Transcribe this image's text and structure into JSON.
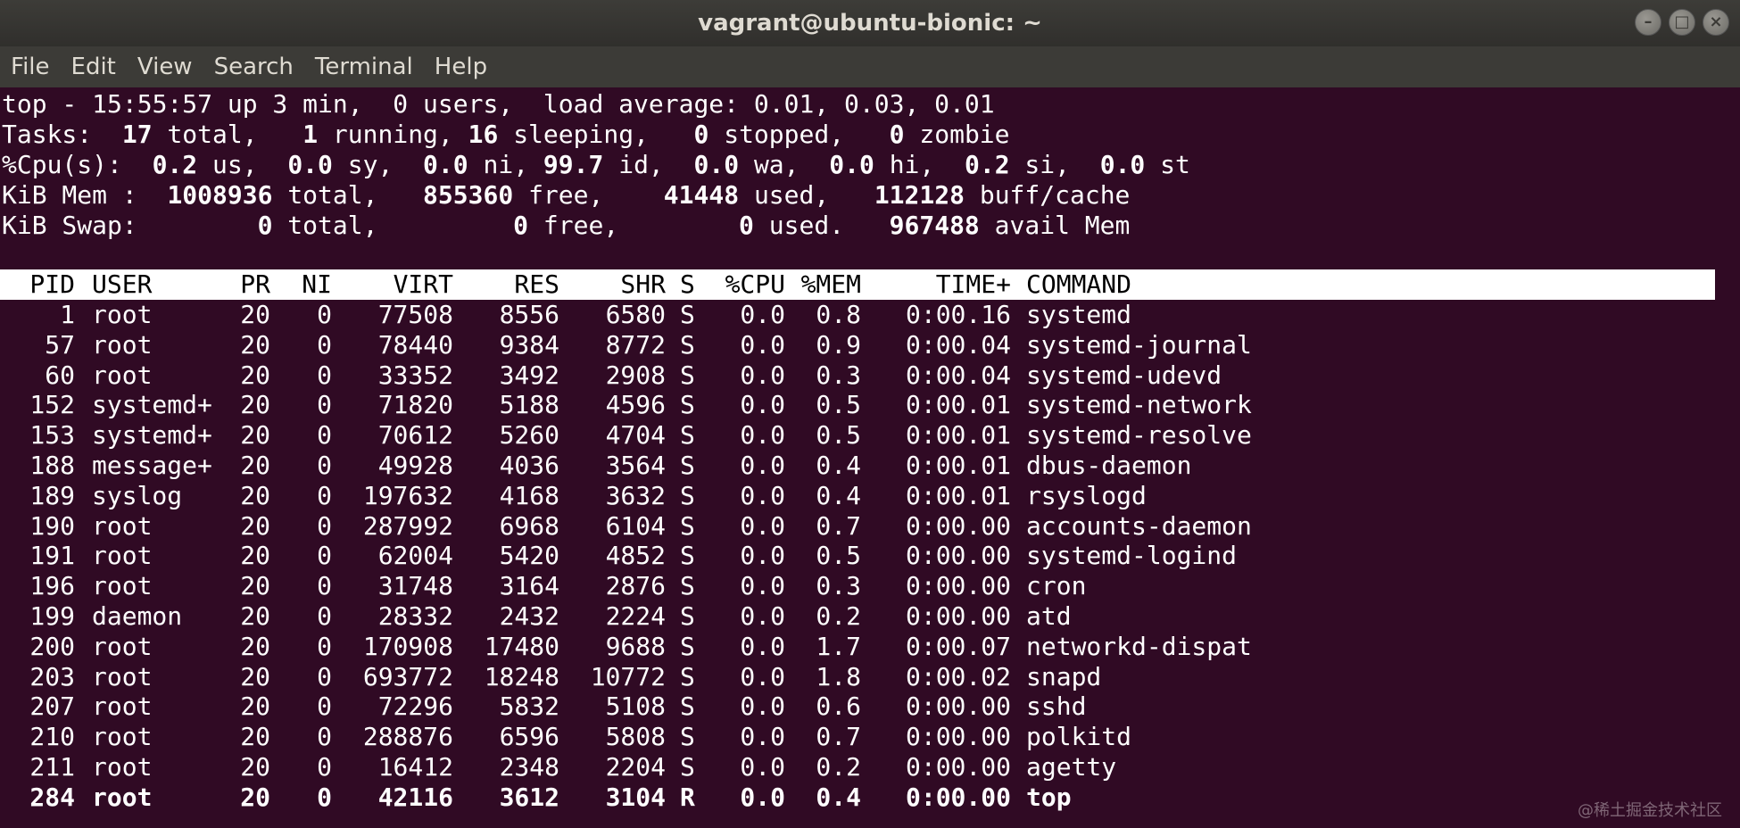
{
  "window": {
    "title": "vagrant@ubuntu-bionic: ~",
    "buttons": [
      "–",
      "□",
      "×"
    ]
  },
  "menu": [
    "File",
    "Edit",
    "View",
    "Search",
    "Terminal",
    "Help"
  ],
  "summary": {
    "line1": "top - 15:55:57 up 3 min,  0 users,  load average: 0.01, 0.03, 0.01",
    "tasks": {
      "label": "Tasks:",
      "total": "17",
      "total_lbl": "total,",
      "running": "1",
      "running_lbl": "running,",
      "sleeping": "16",
      "sleeping_lbl": "sleeping,",
      "stopped": "0",
      "stopped_lbl": "stopped,",
      "zombie": "0",
      "zombie_lbl": "zombie"
    },
    "cpu": {
      "label": "%Cpu(s):",
      "us": "0.2",
      "us_lbl": "us,",
      "sy": "0.0",
      "sy_lbl": "sy,",
      "ni": "0.0",
      "ni_lbl": "ni,",
      "id": "99.7",
      "id_lbl": "id,",
      "wa": "0.0",
      "wa_lbl": "wa,",
      "hi": "0.0",
      "hi_lbl": "hi,",
      "si": "0.2",
      "si_lbl": "si,",
      "st": "0.0",
      "st_lbl": "st"
    },
    "mem": {
      "label": "KiB Mem :",
      "total": "1008936",
      "total_lbl": "total,",
      "free": "855360",
      "free_lbl": "free,",
      "used": "41448",
      "used_lbl": "used,",
      "buff": "112128",
      "buff_lbl": "buff/cache"
    },
    "swap": {
      "label": "KiB Swap:",
      "total": "0",
      "total_lbl": "total,",
      "free": "0",
      "free_lbl": "free,",
      "used": "0",
      "used_lbl": "used.",
      "avail": "967488",
      "avail_lbl": "avail Mem"
    }
  },
  "table": {
    "headers": [
      "PID",
      "USER",
      "PR",
      "NI",
      "VIRT",
      "RES",
      "SHR",
      "S",
      "%CPU",
      "%MEM",
      "TIME+",
      "COMMAND"
    ],
    "rows": [
      [
        "1",
        "root",
        "20",
        "0",
        "77508",
        "8556",
        "6580",
        "S",
        "0.0",
        "0.8",
        "0:00.16",
        "systemd"
      ],
      [
        "57",
        "root",
        "20",
        "0",
        "78440",
        "9384",
        "8772",
        "S",
        "0.0",
        "0.9",
        "0:00.04",
        "systemd-journal"
      ],
      [
        "60",
        "root",
        "20",
        "0",
        "33352",
        "3492",
        "2908",
        "S",
        "0.0",
        "0.3",
        "0:00.04",
        "systemd-udevd"
      ],
      [
        "152",
        "systemd+",
        "20",
        "0",
        "71820",
        "5188",
        "4596",
        "S",
        "0.0",
        "0.5",
        "0:00.01",
        "systemd-network"
      ],
      [
        "153",
        "systemd+",
        "20",
        "0",
        "70612",
        "5260",
        "4704",
        "S",
        "0.0",
        "0.5",
        "0:00.01",
        "systemd-resolve"
      ],
      [
        "188",
        "message+",
        "20",
        "0",
        "49928",
        "4036",
        "3564",
        "S",
        "0.0",
        "0.4",
        "0:00.01",
        "dbus-daemon"
      ],
      [
        "189",
        "syslog",
        "20",
        "0",
        "197632",
        "4168",
        "3632",
        "S",
        "0.0",
        "0.4",
        "0:00.01",
        "rsyslogd"
      ],
      [
        "190",
        "root",
        "20",
        "0",
        "287992",
        "6968",
        "6104",
        "S",
        "0.0",
        "0.7",
        "0:00.00",
        "accounts-daemon"
      ],
      [
        "191",
        "root",
        "20",
        "0",
        "62004",
        "5420",
        "4852",
        "S",
        "0.0",
        "0.5",
        "0:00.00",
        "systemd-logind"
      ],
      [
        "196",
        "root",
        "20",
        "0",
        "31748",
        "3164",
        "2876",
        "S",
        "0.0",
        "0.3",
        "0:00.00",
        "cron"
      ],
      [
        "199",
        "daemon",
        "20",
        "0",
        "28332",
        "2432",
        "2224",
        "S",
        "0.0",
        "0.2",
        "0:00.00",
        "atd"
      ],
      [
        "200",
        "root",
        "20",
        "0",
        "170908",
        "17480",
        "9688",
        "S",
        "0.0",
        "1.7",
        "0:00.07",
        "networkd-dispat"
      ],
      [
        "203",
        "root",
        "20",
        "0",
        "693772",
        "18248",
        "10772",
        "S",
        "0.0",
        "1.8",
        "0:00.02",
        "snapd"
      ],
      [
        "207",
        "root",
        "20",
        "0",
        "72296",
        "5832",
        "5108",
        "S",
        "0.0",
        "0.6",
        "0:00.00",
        "sshd"
      ],
      [
        "210",
        "root",
        "20",
        "0",
        "288876",
        "6596",
        "5808",
        "S",
        "0.0",
        "0.7",
        "0:00.00",
        "polkitd"
      ],
      [
        "211",
        "root",
        "20",
        "0",
        "16412",
        "2348",
        "2204",
        "S",
        "0.0",
        "0.2",
        "0:00.00",
        "agetty"
      ],
      [
        "284",
        "root",
        "20",
        "0",
        "42116",
        "3612",
        "3104",
        "R",
        "0.0",
        "0.4",
        "0:00.00",
        "top"
      ]
    ]
  },
  "watermark": "@稀土掘金技术社区"
}
